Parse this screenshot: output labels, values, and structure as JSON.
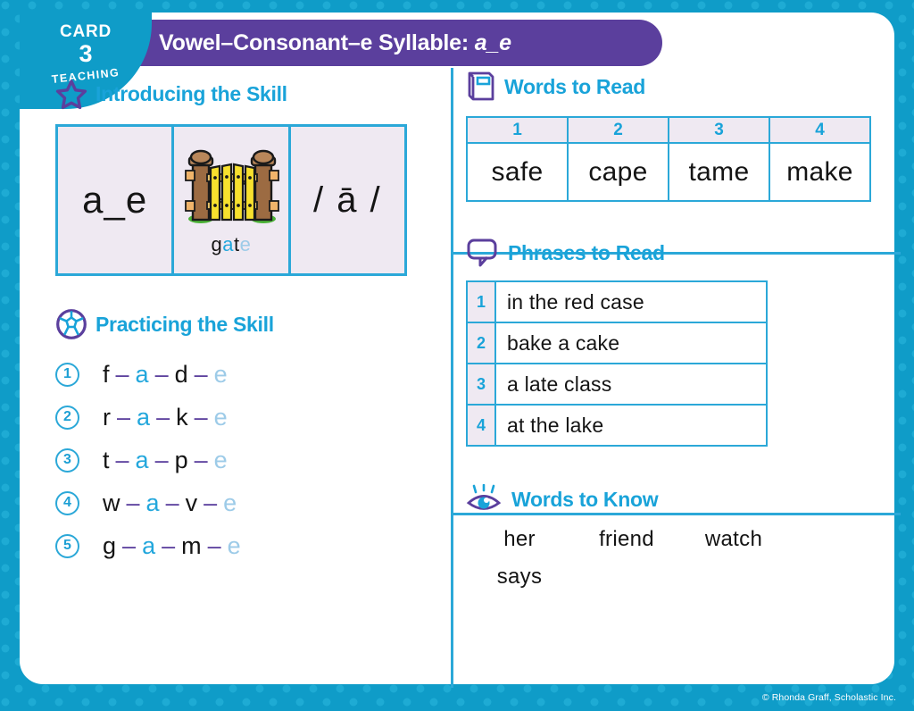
{
  "badge": {
    "card_label": "CARD",
    "number": "3",
    "type_label": "TEACHING"
  },
  "header": {
    "title_main": "Vowel–Consonant–e Syllable:",
    "title_emphasis": "a_e"
  },
  "sections": {
    "introducing": {
      "title": "Introducing the Skill",
      "icon": "star-icon",
      "pattern": "a_e",
      "picture_icon": "gate-illustration",
      "picture_word_parts": [
        {
          "text": "g",
          "color": "black"
        },
        {
          "text": "a",
          "color": "blue"
        },
        {
          "text": "t",
          "color": "black"
        },
        {
          "text": "e",
          "color": "lightblue"
        }
      ],
      "picture_word": "gate",
      "sound": "/ ā /"
    },
    "practicing": {
      "title": "Practicing the Skill",
      "icon": "soccer-ball-icon",
      "items": [
        {
          "num": "1",
          "letters": [
            "f",
            "a",
            "d",
            "e"
          ]
        },
        {
          "num": "2",
          "letters": [
            "r",
            "a",
            "k",
            "e"
          ]
        },
        {
          "num": "3",
          "letters": [
            "t",
            "a",
            "p",
            "e"
          ]
        },
        {
          "num": "4",
          "letters": [
            "w",
            "a",
            "v",
            "e"
          ]
        },
        {
          "num": "5",
          "letters": [
            "g",
            "a",
            "m",
            "e"
          ]
        }
      ]
    },
    "words_to_read": {
      "title": "Words to Read",
      "icon": "book-icon",
      "headers": [
        "1",
        "2",
        "3",
        "4"
      ],
      "words": [
        "safe",
        "cape",
        "tame",
        "make"
      ]
    },
    "phrases_to_read": {
      "title": "Phrases to Read",
      "icon": "speech-bubble-icon",
      "rows": [
        {
          "num": "1",
          "text": "in the red case"
        },
        {
          "num": "2",
          "text": "bake a cake"
        },
        {
          "num": "3",
          "text": "a late class"
        },
        {
          "num": "4",
          "text": "at the lake"
        }
      ]
    },
    "words_to_know": {
      "title": "Words to Know",
      "icon": "eye-icon",
      "words": [
        "her",
        "friend",
        "watch",
        "says"
      ]
    }
  },
  "footer": {
    "copyright": "© Rhonda Graff, Scholastic Inc."
  },
  "colors": {
    "frame_teal": "#0f9cc8",
    "banner_purple": "#5b3f9d",
    "heading_blue": "#19a3d9",
    "border_blue": "#2ba8d8",
    "cell_lavender": "#efe9f2",
    "vowel_blue": "#23a7dc",
    "silent_e_blue": "#9dcbe8"
  }
}
